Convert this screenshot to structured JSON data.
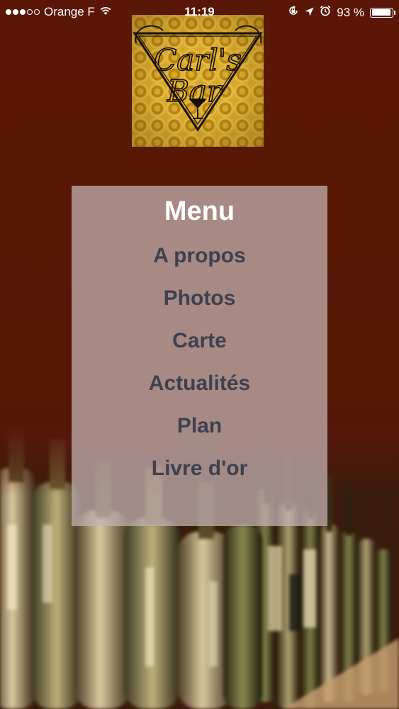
{
  "status_bar": {
    "carrier": "Orange F",
    "time": "11:19",
    "battery_percent": "93 %",
    "battery_level": 0.93,
    "signal_bars_filled": 3,
    "signal_bars_total": 5,
    "icons": [
      "wifi-icon",
      "rotation-lock-icon",
      "location-arrow-icon",
      "alarm-icon",
      "battery-icon"
    ]
  },
  "logo": {
    "text_line1": "Carl's",
    "text_line2": "Bar",
    "background_color": "#c9951e"
  },
  "menu": {
    "title": "Menu",
    "items": [
      {
        "label": "A propos"
      },
      {
        "label": "Photos"
      },
      {
        "label": "Carte"
      },
      {
        "label": "Actualités"
      },
      {
        "label": "Plan"
      },
      {
        "label": "Livre d'or"
      }
    ]
  },
  "colors": {
    "background": "#5a1707",
    "menu_text": "#3d4150",
    "menu_title": "#ffffff",
    "panel": "#c4b2b2"
  }
}
